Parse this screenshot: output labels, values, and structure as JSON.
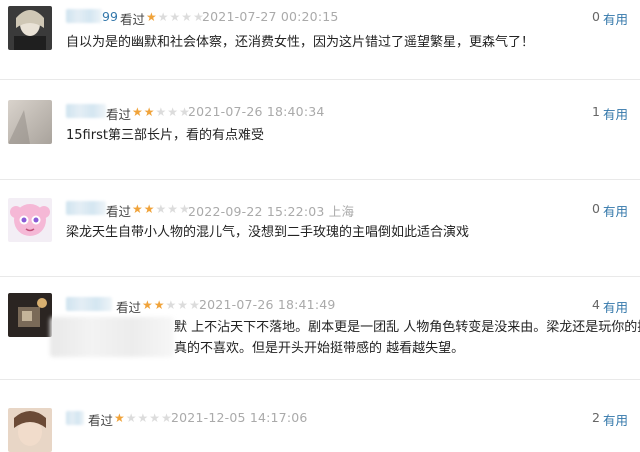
{
  "reviews": [
    {
      "name_visible": "99",
      "watched": "看过",
      "rating": 1,
      "time": "2021-07-27 00:20:15",
      "location": "",
      "useful_count": "0",
      "useful_label": "有用",
      "text": "自以为是的幽默和社会体察，还消费女性，因为这片错过了遥望繁星，更森气了！"
    },
    {
      "name_visible": "",
      "watched": "看过",
      "rating": 2,
      "time": "2021-07-26 18:40:34",
      "location": "",
      "useful_count": "1",
      "useful_label": "有用",
      "text": "15first第三部长片，看的有点难受"
    },
    {
      "name_visible": "",
      "watched": "看过",
      "rating": 2,
      "time": "2022-09-22 15:22:03",
      "location": "上海",
      "useful_count": "0",
      "useful_label": "有用",
      "text": "梁龙天生自带小人物的混儿气，没想到二手玫瑰的主唱倒如此适合演戏"
    },
    {
      "name_visible": "",
      "watched": "看过",
      "rating": 2,
      "time": "2021-07-26 18:41:49",
      "location": "",
      "useful_count": "4",
      "useful_label": "有用",
      "text_line1": "默 上不沾天下不落地。剧本更是一团乱 人物角色转变是没来由。梁龙还是玩你的摇",
      "text_line2": "真的不喜欢。但是开头开始挺带感的 越看越失望。"
    },
    {
      "name_visible": "",
      "watched": "看过",
      "rating": 1,
      "time": "2021-12-05 14:17:06",
      "location": "",
      "useful_count": "2",
      "useful_label": "有用",
      "text": ""
    }
  ],
  "star_glyph": "★",
  "colors": {
    "star_on": "#f0a33a",
    "star_off": "#dcdcdc",
    "link": "#3377aa"
  }
}
